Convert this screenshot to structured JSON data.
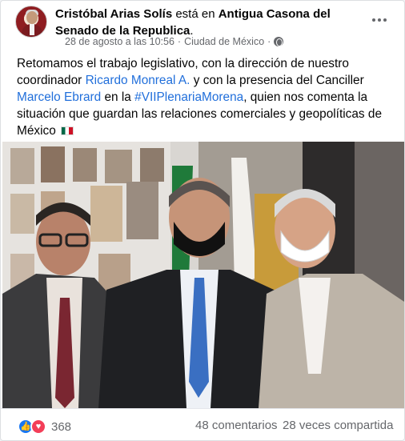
{
  "post": {
    "author": "Cristóbal Arias Solís",
    "checkin_word": "está en",
    "location_title": "Antigua Casona del Senado de la Republica",
    "title_period": ".",
    "timestamp": "28 de agosto a las 10:56",
    "separator": "·",
    "city": "Ciudad de México",
    "separator2": "·",
    "privacy_icon": "globe-icon",
    "more_icon": "more-options-icon",
    "text_part1": "Retomamos el trabajo legislativo, con la dirección de nuestro coordinador ",
    "mention1": "Ricardo Monreal A.",
    "text_part2": "  y con la presencia del Canciller ",
    "mention2": "Marcelo Ebrard",
    "text_part3": " en la ",
    "hashtag": "#VIIPlenariaMorena",
    "text_part4": ", quien nos comenta la situación que guardan las relaciones comerciales y geopolíticas de México ",
    "flag_icon": "mexico-flag-icon",
    "link_color": "#216fdb"
  },
  "footer": {
    "like_icon": "like-icon",
    "like_glyph": "👍",
    "love_icon": "love-icon",
    "love_glyph": "♥",
    "reaction_count": "368",
    "comments": "48 comentarios",
    "shares": "28 veces compartida"
  }
}
